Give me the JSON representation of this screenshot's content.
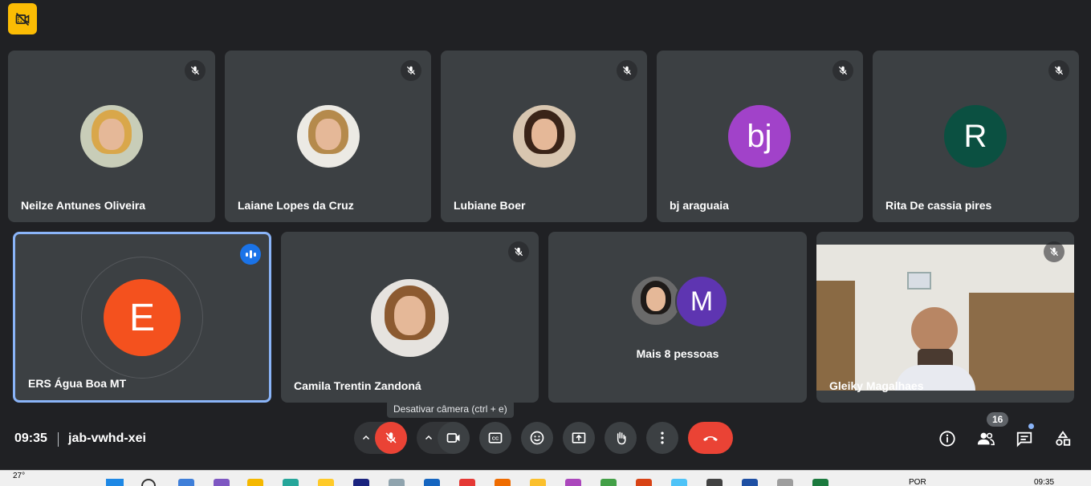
{
  "participants_row1": [
    {
      "name": "Neilze Antunes Oliveira",
      "avatar_type": "photo",
      "muted": true
    },
    {
      "name": "Laiane Lopes da Cruz",
      "avatar_type": "photo",
      "muted": true
    },
    {
      "name": "Lubiane Boer",
      "avatar_type": "photo",
      "muted": true
    },
    {
      "name": "bj araguaia",
      "avatar_type": "initials",
      "initials": "bj",
      "color": "#a142c9",
      "muted": true
    },
    {
      "name": "Rita De cassia pires",
      "avatar_type": "initials",
      "initials": "R",
      "color": "#0b5041",
      "muted": true
    }
  ],
  "participants_row2": [
    {
      "name": "ERS Água Boa MT",
      "avatar_type": "initials",
      "initials": "E",
      "color": "#f4511e",
      "speaking": true
    },
    {
      "name": "Camila Trentin Zandoná",
      "avatar_type": "photo",
      "muted": true
    },
    {
      "name": "Mais 8 pessoas",
      "avatar_type": "group",
      "initials": "M",
      "color": "#5e35b1"
    },
    {
      "name": "Gleiky Magalhaes",
      "avatar_type": "video",
      "muted": true
    }
  ],
  "bottom_bar": {
    "time": "09:35",
    "meeting_code": "jab-vwhd-xei",
    "tooltip": "Desativar câmera (ctrl + e)",
    "participants_count": "16"
  },
  "icons": {
    "top_badge": "camera-off-icon",
    "mic": "mic-off-icon",
    "camera": "videocam-icon",
    "captions": "closed-captions-icon",
    "emoji": "emoji-icon",
    "present": "present-screen-icon",
    "hand": "raise-hand-icon",
    "more": "more-vert-icon",
    "leave": "call-end-icon",
    "info": "info-icon",
    "people": "people-icon",
    "chat": "chat-icon",
    "activities": "activities-icon"
  },
  "colors": {
    "background": "#202124",
    "tile": "#3c4043",
    "danger": "#ea4335",
    "accent": "#8ab4f8",
    "badge": "#fbbc04"
  },
  "taskbar": {
    "weather": "27°",
    "language": "POR",
    "time": "09:35"
  }
}
